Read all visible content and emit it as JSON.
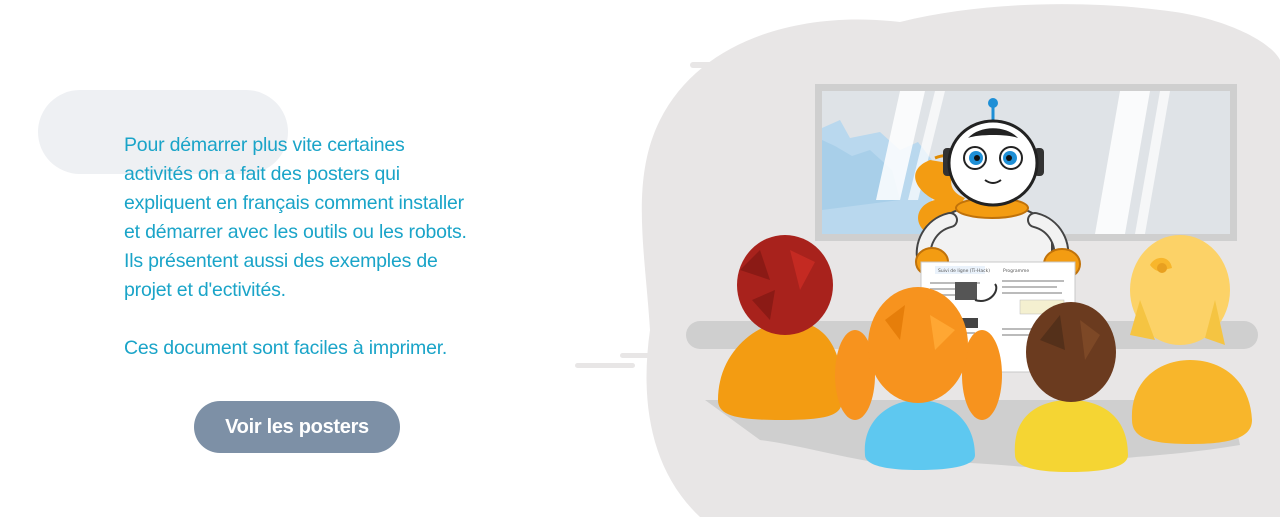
{
  "intro": {
    "paragraph1": [
      "Pour démarrer plus vite certaines",
      "activités on a fait des posters qui",
      "expliquent en français  comment installer",
      "et démarrer avec les outils ou les robots.",
      "Ils présentent aussi des exemples de",
      "projet et d'ectivités."
    ],
    "paragraph2": "Ces document sont faciles à imprimer.",
    "cta_label": "Voir les posters"
  },
  "poster": {
    "title": "Suivi de ligne (Ti-Hack)",
    "section": "Programme"
  },
  "colors": {
    "text_accent": "#1aa4c8",
    "button_bg": "#7d90a6",
    "robot_eye": "#1e8fd6",
    "robot_scarf": "#f39c12"
  }
}
